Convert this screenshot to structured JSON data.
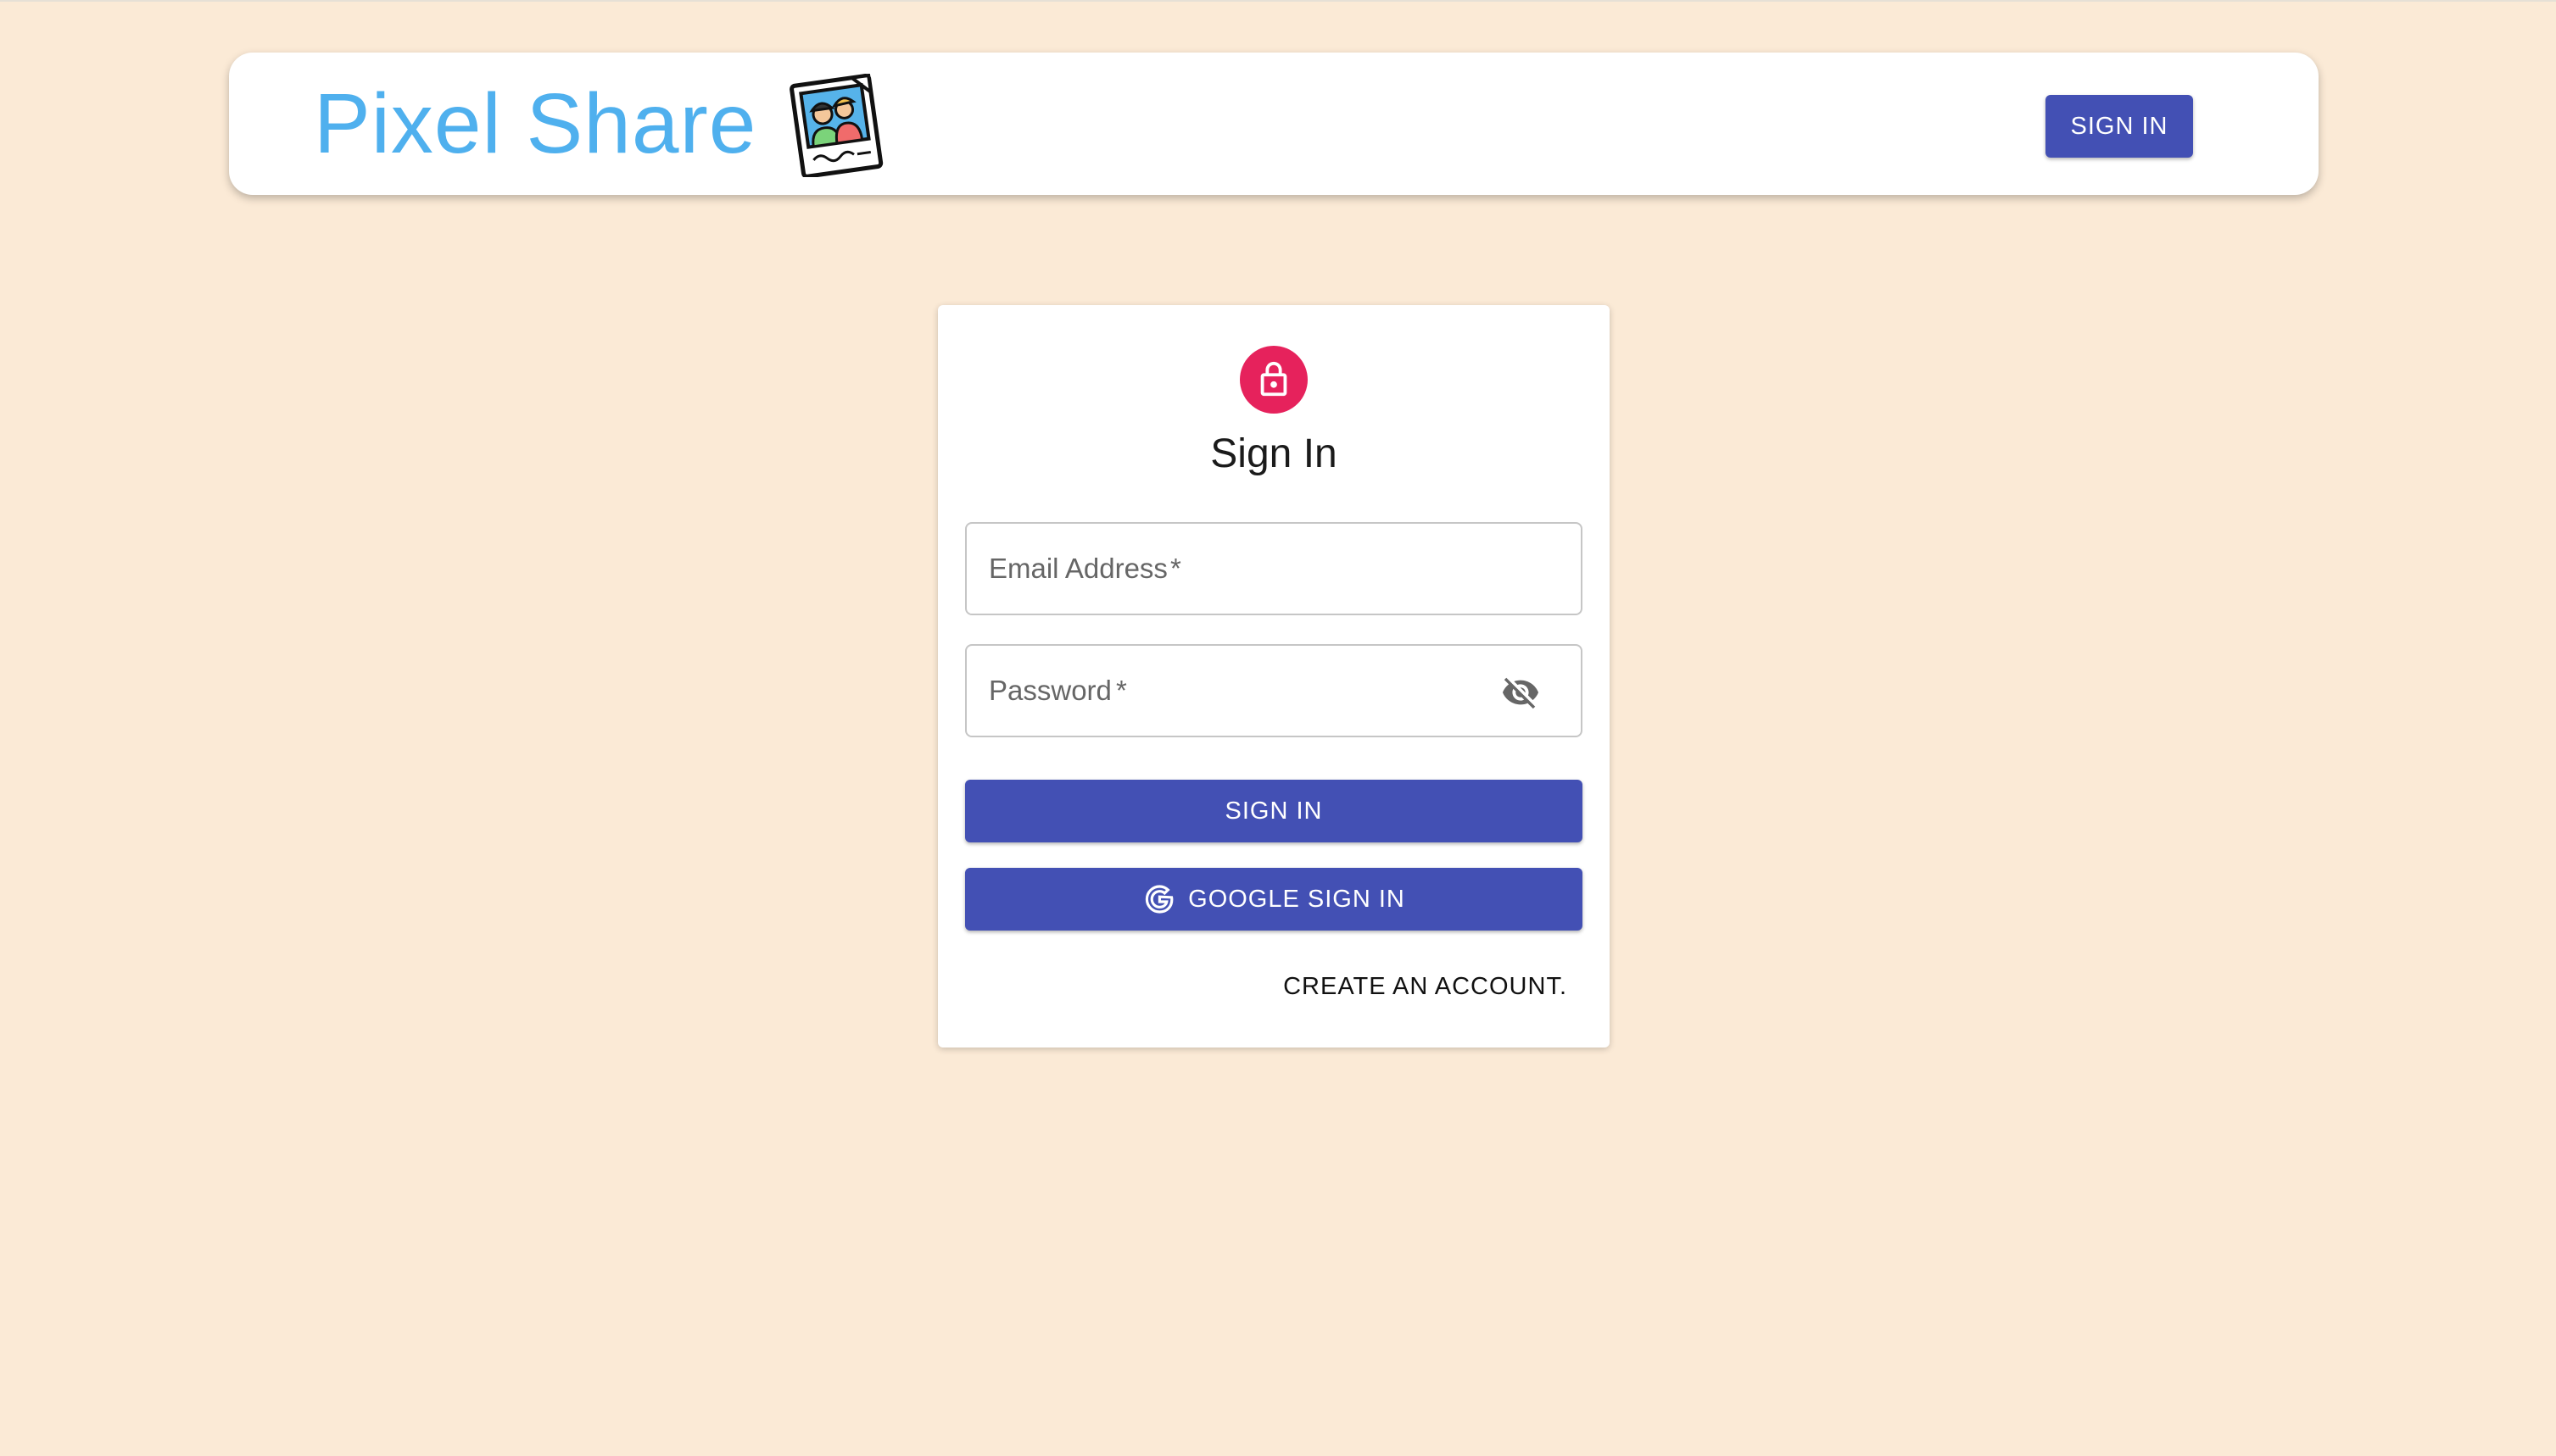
{
  "header": {
    "brand_title": "Pixel Share",
    "logo_icon": "photo-frame-people-icon",
    "sign_in_label": "SIGN IN"
  },
  "login": {
    "title": "Sign In",
    "lock_icon": "lock-icon",
    "email": {
      "placeholder": "Email Address",
      "required_mark": "*",
      "value": ""
    },
    "password": {
      "placeholder": "Password",
      "required_mark": "*",
      "value": "",
      "toggle_icon": "eye-off-icon"
    },
    "sign_in_label": "SIGN IN",
    "google_sign_in_label": "GOOGLE SIGN IN",
    "google_icon": "google-g-icon",
    "create_account_label": "CREATE AN ACCOUNT."
  },
  "colors": {
    "page_background": "#fbead6",
    "brand_text": "#4fb0ee",
    "primary_button": "#4350b4",
    "lock_avatar": "#e6225c"
  }
}
